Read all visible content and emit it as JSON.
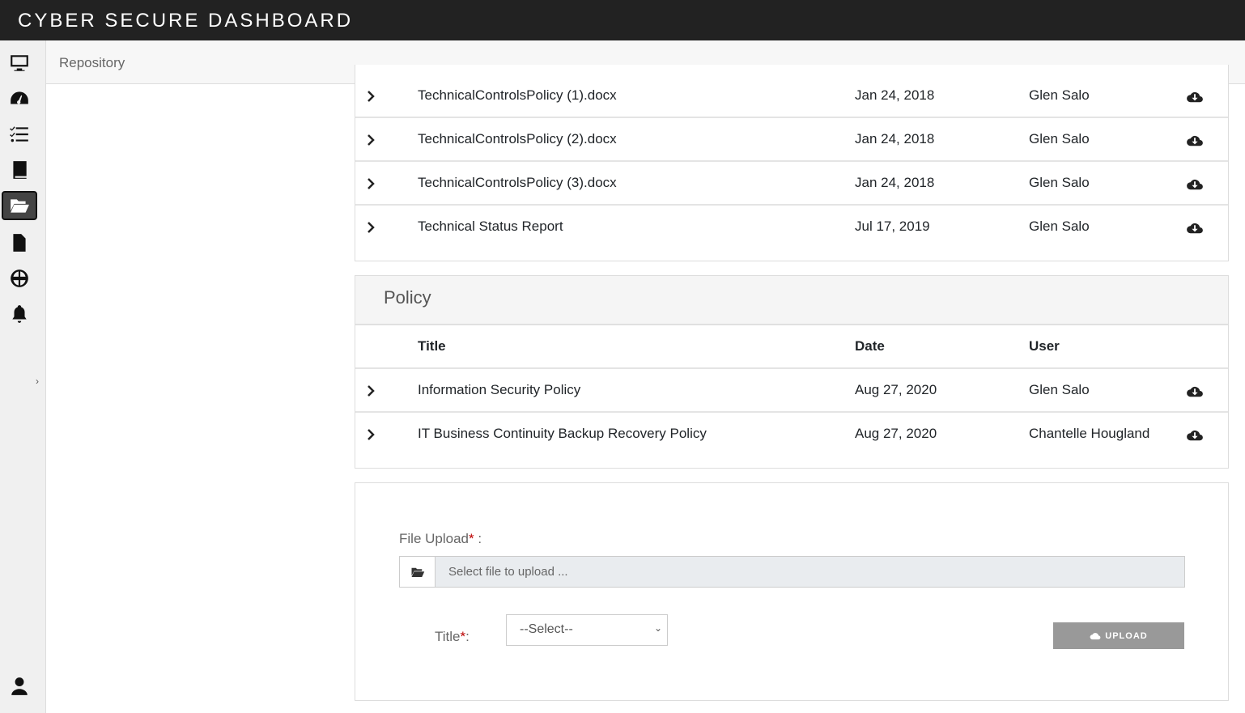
{
  "app": {
    "title": "CYBER SECURE DASHBOARD"
  },
  "breadcrumb": "Repository",
  "sidebar": {
    "items": [
      "monitor",
      "dashboard",
      "checklist",
      "book",
      "repository",
      "document",
      "globe",
      "notifications",
      "user"
    ],
    "active": "repository"
  },
  "section1": {
    "rows": [
      {
        "title": "TechnicalControlsPolicy (1).docx",
        "date": "Jan 24, 2018",
        "user": "Glen Salo"
      },
      {
        "title": "TechnicalControlsPolicy (2).docx",
        "date": "Jan 24, 2018",
        "user": "Glen Salo"
      },
      {
        "title": "TechnicalControlsPolicy (3).docx",
        "date": "Jan 24, 2018",
        "user": "Glen Salo"
      },
      {
        "title": "Technical Status Report",
        "date": "Jul 17, 2019",
        "user": "Glen Salo"
      }
    ]
  },
  "policy": {
    "heading": "Policy",
    "columns": {
      "title": "Title",
      "date": "Date",
      "user": "User"
    },
    "rows": [
      {
        "title": "Information Security Policy",
        "date": "Aug 27, 2020",
        "user": "Glen Salo"
      },
      {
        "title": "IT Business Continuity Backup Recovery Policy",
        "date": "Aug 27, 2020",
        "user": "Chantelle Hougland"
      }
    ]
  },
  "upload": {
    "file_label": "File Upload",
    "file_suffix": " :",
    "required": "*",
    "file_placeholder": "Select file to upload ...",
    "title_label": "Title",
    "title_suffix": ":",
    "select_value": "--Select--",
    "button": "UPLOAD"
  }
}
